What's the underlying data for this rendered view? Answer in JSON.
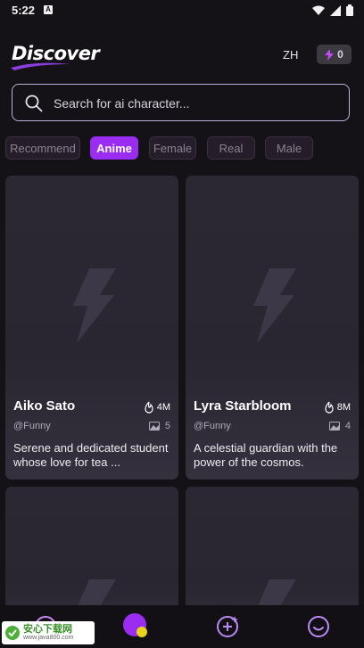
{
  "status_bar": {
    "time": "5:22"
  },
  "header": {
    "title": "Discover",
    "language": "ZH",
    "energy_count": "0"
  },
  "search": {
    "placeholder": "Search for ai character..."
  },
  "tabs": [
    {
      "label": "Recommend",
      "active": false
    },
    {
      "label": "Anime",
      "active": true
    },
    {
      "label": "Female",
      "active": false
    },
    {
      "label": "Real",
      "active": false
    },
    {
      "label": "Male",
      "active": false
    }
  ],
  "cards": [
    {
      "name": "Aiko Sato",
      "popularity": "4M",
      "handle": "@Funny",
      "image_count": "5",
      "description": "Serene and dedicated student whose love for tea ..."
    },
    {
      "name": "Lyra Starbloom",
      "popularity": "8M",
      "handle": "@Funny",
      "image_count": "4",
      "description": "A celestial guardian with the power of the cosmos."
    },
    {
      "name": "",
      "popularity": "",
      "handle": "",
      "image_count": "",
      "description": ""
    },
    {
      "name": "",
      "popularity": "",
      "handle": "",
      "image_count": "",
      "description": ""
    }
  ],
  "watermark": {
    "line1": "安心下载网",
    "line2": "www.java800.com"
  },
  "colors": {
    "accent": "#9b2cf2",
    "background": "#141117",
    "card": "#2b2833"
  }
}
